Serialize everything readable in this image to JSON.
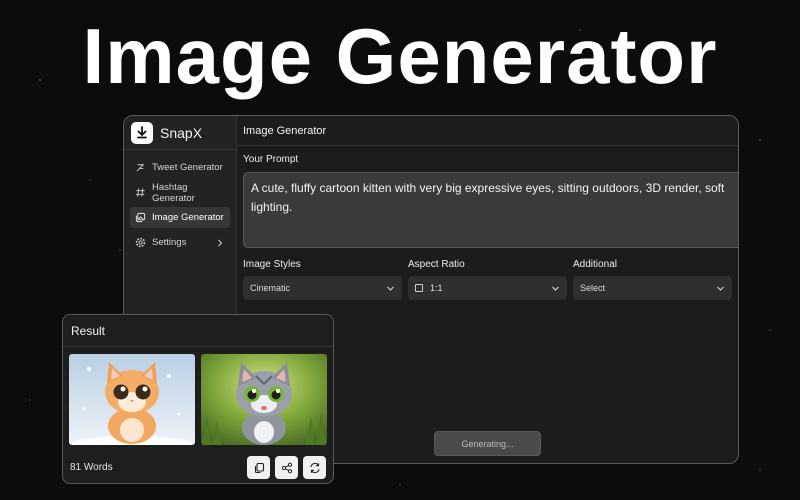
{
  "hero": {
    "title": "Image Generator"
  },
  "app": {
    "name": "SnapX",
    "page_title": "Image Generator",
    "icon": "download-icon"
  },
  "sidebar": {
    "items": [
      {
        "label": "Tweet Generator",
        "icon": "quill-icon",
        "active": false
      },
      {
        "label": "Hashtag Generator",
        "icon": "hashtag-icon",
        "active": false
      },
      {
        "label": "Image Generator",
        "icon": "image-stack-icon",
        "active": true
      },
      {
        "label": "Settings",
        "icon": "gear-icon",
        "active": false,
        "has_submenu": true
      }
    ]
  },
  "prompt": {
    "label": "Your Prompt",
    "value": "A cute, fluffy cartoon kitten with very big expressive eyes, sitting outdoors, 3D render, soft lighting."
  },
  "options": {
    "image_styles": {
      "label": "Image Styles",
      "value": "Cinematic"
    },
    "aspect_ratio": {
      "label": "Aspect Ratio",
      "value": "1:1"
    },
    "additional": {
      "label": "Additional",
      "value": "Select"
    }
  },
  "generate_button": {
    "label": "Generating..."
  },
  "result": {
    "title": "Result",
    "word_count": "81 Words",
    "images": [
      "orange kitten in snow",
      "grey kitten in grass"
    ],
    "actions": [
      "copy-icon",
      "share-icon",
      "refresh-icon"
    ]
  },
  "colors": {
    "background": "#0c0c0c",
    "window": "#1c1c1c",
    "sidebar": "#232323",
    "prompt_box": "#3a3a3a",
    "active_item": "#363636"
  }
}
